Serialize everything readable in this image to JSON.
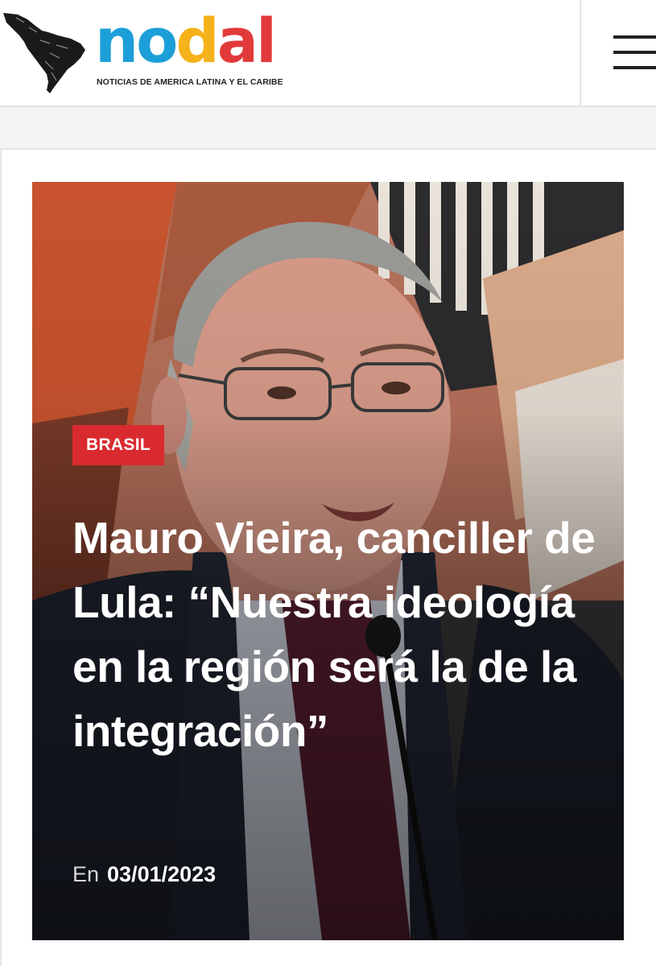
{
  "header": {
    "logo": {
      "letters": [
        "n",
        "o",
        "d",
        "a",
        "l"
      ],
      "letter_colors": [
        "#1c9fd8",
        "#1c9fd8",
        "#f6b21b",
        "#e23a3a",
        "#e23a3a"
      ],
      "tagline": "NOTICIAS DE AMERICA LATINA Y EL CARIBE",
      "map_icon": "latin-america-map-icon"
    },
    "menu_icon": "hamburger-menu-icon"
  },
  "article": {
    "category": "BRASIL",
    "title": "Mauro Vieira, canciller de Lula: “Nuestra ideología en la región será la de la integración”",
    "date_prefix": "En",
    "date": "03/01/2023",
    "badge_color": "#d92b2f"
  }
}
